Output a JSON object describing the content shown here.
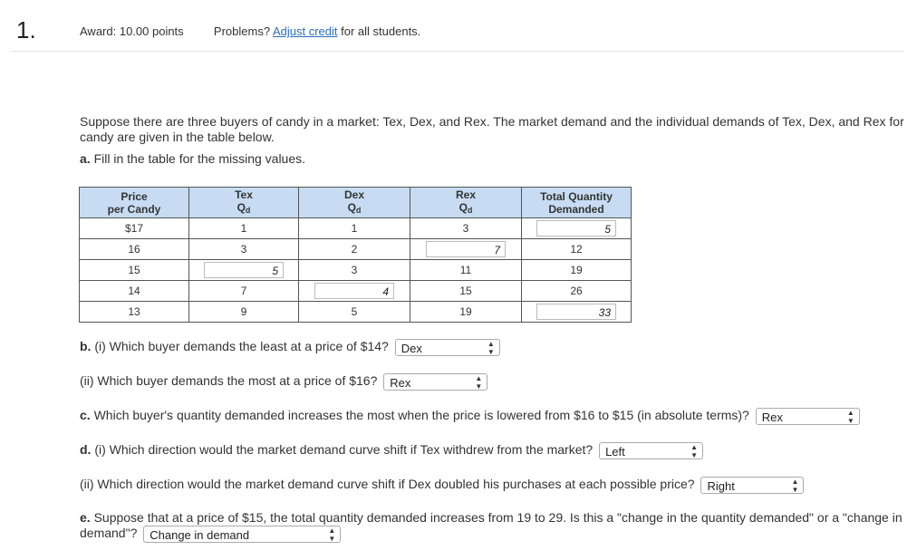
{
  "header": {
    "number": "1.",
    "award": "Award: 10.00 points",
    "problems_prefix": "Problems?",
    "adjust_link": "Adjust credit",
    "problems_suffix": "for all students."
  },
  "intro": "Suppose there are three buyers of candy in a market: Tex, Dex, and Rex. The market demand and the individual demands of Tex, Dex, and Rex for candy are given in the table below.",
  "part_a": {
    "label": "a.",
    "text": "Fill in the table for the missing values."
  },
  "table": {
    "headers": [
      {
        "line1": "Price",
        "line2": "per Candy"
      },
      {
        "line1": "Tex",
        "line2": "Q",
        "sub": "d"
      },
      {
        "line1": "Dex",
        "line2": "Q",
        "sub": "d"
      },
      {
        "line1": "Rex",
        "line2": "Q",
        "sub": "d"
      },
      {
        "line1": "Total Quantity",
        "line2": "Demanded"
      }
    ],
    "rows": [
      {
        "price": "$17",
        "tex": "1",
        "dex": "1",
        "rex": "3",
        "total": "5"
      },
      {
        "price": "16",
        "tex": "3",
        "dex": "2",
        "rex": "7",
        "total": "12"
      },
      {
        "price": "15",
        "tex": "5",
        "dex": "3",
        "rex": "11",
        "total": "19"
      },
      {
        "price": "14",
        "tex": "7",
        "dex": "4",
        "rex": "15",
        "total": "26"
      },
      {
        "price": "13",
        "tex": "9",
        "dex": "5",
        "rex": "19",
        "total": "33"
      }
    ]
  },
  "questions": {
    "b1": {
      "label": "b.",
      "text": "(i) Which buyer demands the least at a price of $14?",
      "answer": "Dex"
    },
    "b2": {
      "text": "(ii) Which buyer demands the most at a price of $16?",
      "answer": "Rex"
    },
    "c": {
      "label": "c.",
      "text": "Which buyer's quantity demanded increases the most when the price is lowered from $16 to $15 (in absolute terms)?",
      "answer": "Rex"
    },
    "d1": {
      "label": "d.",
      "text": "(i) Which direction would the market demand curve shift if Tex withdrew from the market?",
      "answer": "Left"
    },
    "d2": {
      "text": "(ii) Which direction would the market demand curve shift if Dex doubled his purchases at each possible price?",
      "answer": "Right"
    },
    "e": {
      "label": "e.",
      "text": "Suppose that at a price of $15, the total quantity demanded increases from 19 to 29. Is this a \"change in the quantity demanded\" or a \"change in demand\"?",
      "answer": "Change in demand"
    }
  }
}
